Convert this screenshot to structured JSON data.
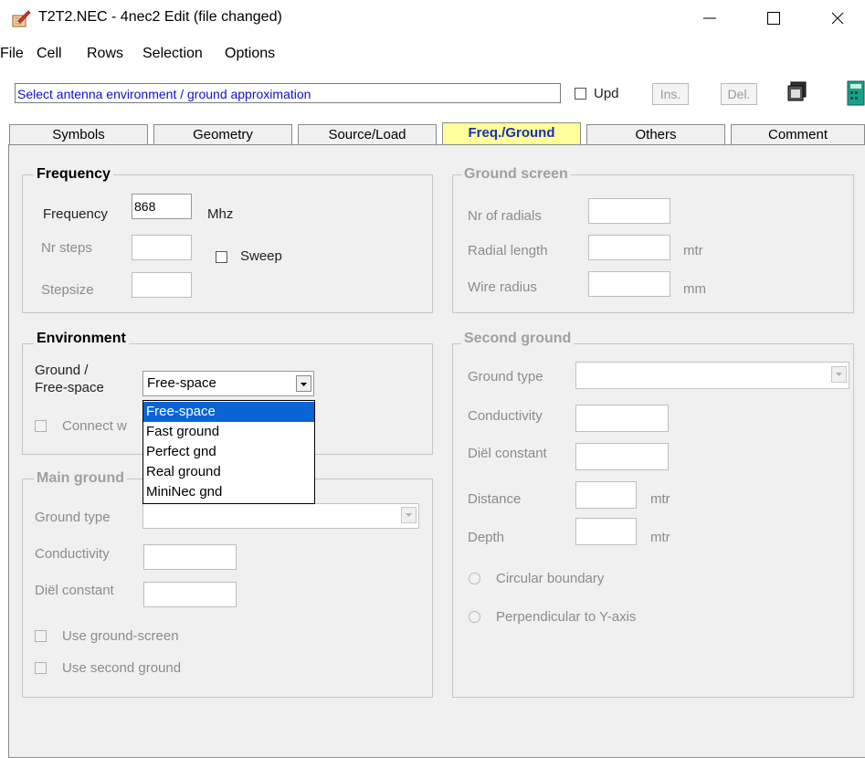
{
  "window": {
    "title": "T2T2.NEC - 4nec2 Edit (file changed)",
    "icon": "edit-icon",
    "min": "—",
    "max": "☐",
    "close": "✕"
  },
  "menu": [
    "File",
    "Cell",
    "Rows",
    "Selection",
    "Options"
  ],
  "toolbar": {
    "hint": "Select antenna environment / ground approximation",
    "upd_label": "Upd",
    "ins_label": "Ins.",
    "del_label": "Del."
  },
  "tabs": [
    "Symbols",
    "Geometry",
    "Source/Load",
    "Freq./Ground",
    "Others",
    "Comment"
  ],
  "active_tab": "Freq./Ground",
  "frequency": {
    "title": "Frequency",
    "freq_label": "Frequency",
    "freq_value": "868",
    "freq_unit": "Mhz",
    "steps_label": "Nr steps",
    "stepsize_label": "Stepsize",
    "sweep_label": "Sweep"
  },
  "ground_screen": {
    "title": "Ground screen",
    "radials_label": "Nr of radials",
    "length_label": "Radial length",
    "length_unit": "mtr",
    "radius_label": "Wire radius",
    "radius_unit": "mm"
  },
  "environment": {
    "title": "Environment",
    "ground_label_1": "Ground  /",
    "ground_label_2": "Free-space",
    "selected": "Free-space",
    "connect_label": "Connect w",
    "options": [
      "Free-space",
      "Fast ground",
      "Perfect gnd",
      "Real ground",
      "MiniNec gnd"
    ]
  },
  "main_ground": {
    "title": "Main ground",
    "type_label": "Ground type",
    "cond_label": "Conductivity",
    "diel_label": "Diël constant",
    "use_screen_label": "Use ground-screen",
    "use_second_label": "Use second ground"
  },
  "second_ground": {
    "title": "Second ground",
    "type_label": "Ground type",
    "cond_label": "Conductivity",
    "diel_label": "Diël constant",
    "distance_label": "Distance",
    "distance_unit": "mtr",
    "depth_label": "Depth",
    "depth_unit": "mtr",
    "circular_label": "Circular boundary",
    "perp_label": "Perpendicular to Y-axis"
  }
}
